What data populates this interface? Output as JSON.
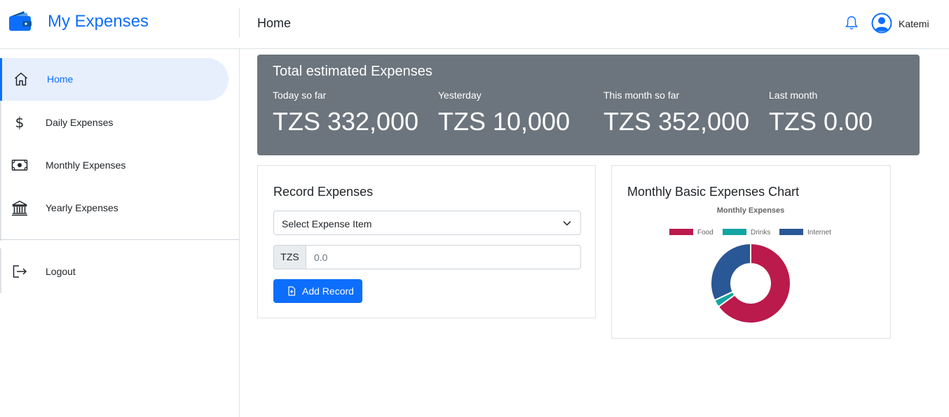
{
  "app": {
    "name": "My Expenses"
  },
  "header": {
    "title": "Home",
    "user_name": "Katemi"
  },
  "sidebar": {
    "items": [
      {
        "label": "Home",
        "icon": "home-icon"
      },
      {
        "label": "Daily Expenses",
        "icon": "dollar-icon"
      },
      {
        "label": "Monthly Expenses",
        "icon": "cash-icon"
      },
      {
        "label": "Yearly Expenses",
        "icon": "bank-icon"
      },
      {
        "label": "Logout",
        "icon": "logout-icon"
      }
    ]
  },
  "summary": {
    "title": "Total estimated Expenses",
    "stats": [
      {
        "label": "Today so far",
        "value": "TZS 332,000"
      },
      {
        "label": "Yesterday",
        "value": "TZS 10,000"
      },
      {
        "label": "This month so far",
        "value": "TZS 352,000"
      },
      {
        "label": "Last month",
        "value": "TZS 0.00"
      }
    ]
  },
  "record": {
    "title": "Record Expenses",
    "select_value": "Select Expense Item",
    "currency": "TZS",
    "amount_placeholder": "0.0",
    "button_label": "Add Record"
  },
  "chart_card": {
    "title": "Monthly Basic Expenses Chart"
  },
  "colors": {
    "primary": "#0d6efd",
    "banner": "#6c757d"
  },
  "chart_data": {
    "type": "pie",
    "variant": "doughnut",
    "title": "Monthly Expenses",
    "legend": "top",
    "categories": [
      "Food",
      "Drinks",
      "Internet"
    ],
    "values": [
      65,
      3,
      32
    ],
    "colors": [
      "#bb1a4c",
      "#13a5a3",
      "#2a5795"
    ]
  }
}
